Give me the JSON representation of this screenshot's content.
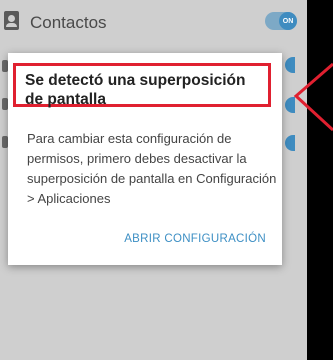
{
  "settings_row": {
    "label": "Contactos",
    "toggle_text": "ON"
  },
  "dialog": {
    "title": "Se detectó una superposición de pantalla",
    "message": "Para cambiar esta configuración de permisos, primero debes desactivar la superposición de pantalla en Configuración > Aplicaciones",
    "action_label": "ABRIR CONFIGURACIÓN"
  },
  "colors": {
    "highlight": "#e02030",
    "accent": "#3d8fc4"
  }
}
